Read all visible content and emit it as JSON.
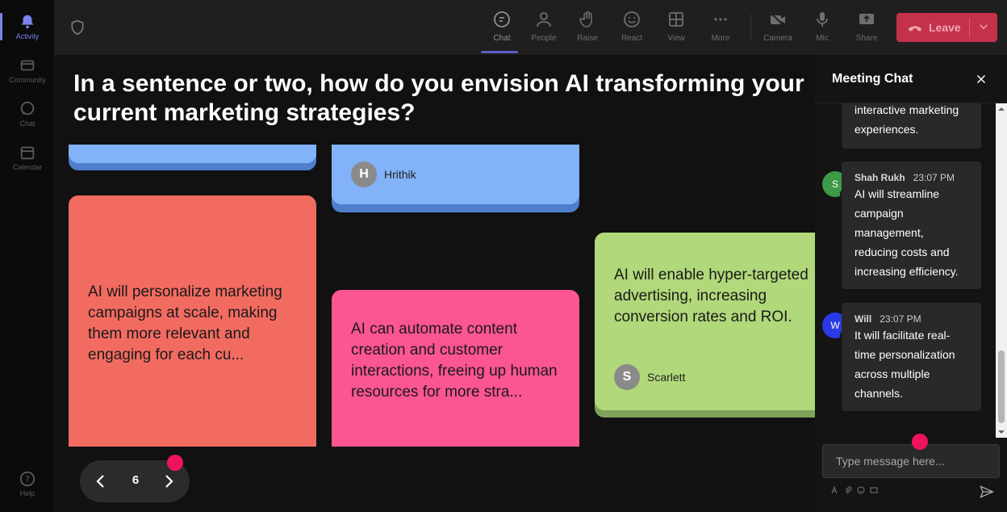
{
  "rail": {
    "items": [
      {
        "label": "Activity"
      },
      {
        "label": "Community"
      },
      {
        "label": "Chat"
      },
      {
        "label": "Calendar"
      }
    ],
    "help": "Help"
  },
  "toolbar": {
    "chat": "Chat",
    "people": "People",
    "raise": "Raise",
    "react": "React",
    "view": "View",
    "more": "More",
    "camera": "Camera",
    "mic": "Mic",
    "share": "Share",
    "leave": "Leave"
  },
  "question": {
    "line1": "In a sentence or two, how do you envision AI transforming your",
    "line2": "current marketing strategies?"
  },
  "notes": [
    {
      "author": "Hrithik",
      "initial": "H"
    },
    {
      "text": "AI will personalize marketing campaigns at scale, making them more relevant and engaging for each cu..."
    },
    {
      "text": "AI can automate content creation and customer interactions, freeing up human resources for more stra..."
    },
    {
      "text": "AI will enable hyper-targeted advertising, increasing conversion rates and ROI.",
      "author": "Scarlett",
      "initial": "S"
    }
  ],
  "pager": {
    "page": "6"
  },
  "chat": {
    "title": "Meeting Chat",
    "messages": [
      {
        "text1": "interactive marketing",
        "text2": "experiences."
      },
      {
        "name": "Shah Rukh",
        "time": "23:07 PM",
        "initial": "S",
        "lines": [
          "AI will streamline",
          "campaign",
          "management,",
          "reducing costs and",
          "increasing efficiency."
        ]
      },
      {
        "name": "Will",
        "time": "23:07 PM",
        "initial": "W",
        "lines": [
          "It will facilitate real-",
          "time personalization",
          "across multiple",
          "channels."
        ]
      }
    ],
    "placeholder": "Type message here..."
  },
  "colors": {
    "note_blue": "#82b2f8",
    "note_red": "#f26b61",
    "note_pink": "#fb5592",
    "note_green": "#b1d87a",
    "leave": "#c4314b",
    "accent": "#5b5fc7",
    "dot": "#f0135c"
  }
}
